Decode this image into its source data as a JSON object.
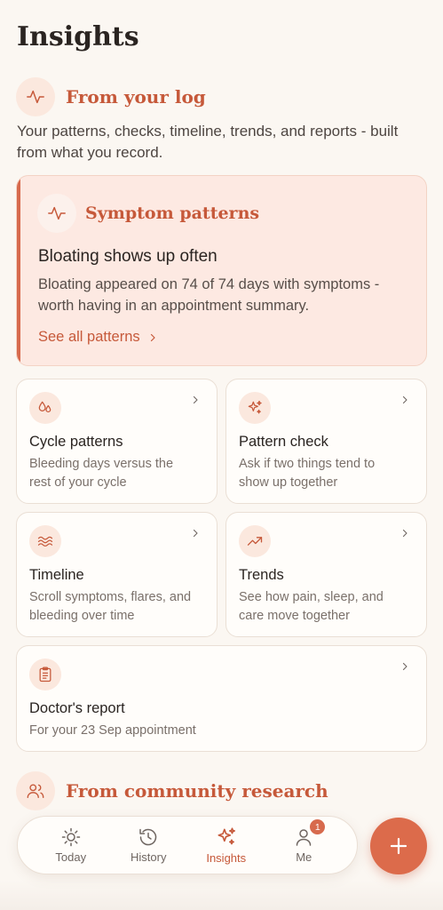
{
  "header": {
    "title": "Insights"
  },
  "from_log": {
    "title": "From your log",
    "description": "Your patterns, checks, timeline, trends, and reports - built from what you record."
  },
  "hero": {
    "title": "Symptom patterns",
    "headline": "Bloating shows up often",
    "body": "Bloating appeared on 74 of 74 days with symptoms - worth having in an appointment summary.",
    "link": "See all patterns"
  },
  "tiles": [
    {
      "title": "Cycle patterns",
      "desc": "Bleeding days versus the rest of your cycle",
      "icon": "drops-icon"
    },
    {
      "title": "Pattern check",
      "desc": "Ask if two things tend to show up together",
      "icon": "sparkles-icon"
    },
    {
      "title": "Timeline",
      "desc": "Scroll symptoms, flares, and bleeding over time",
      "icon": "waves-icon"
    },
    {
      "title": "Trends",
      "desc": "See how pain, sleep, and care move together",
      "icon": "trend-up-icon"
    },
    {
      "title": "Doctor's report",
      "desc": "For your 23 Sep appointment",
      "icon": "clipboard-icon"
    }
  ],
  "community": {
    "title": "From community research"
  },
  "nav": {
    "items": [
      {
        "label": "Today",
        "icon": "sun-icon"
      },
      {
        "label": "History",
        "icon": "history-icon"
      },
      {
        "label": "Insights",
        "icon": "sparkles-icon",
        "active": true
      },
      {
        "label": "Me",
        "icon": "user-icon",
        "badge": "1"
      }
    ]
  },
  "colors": {
    "accent": "#c6593a",
    "fab": "#dc6b4b",
    "background": "#fbf7f2"
  }
}
